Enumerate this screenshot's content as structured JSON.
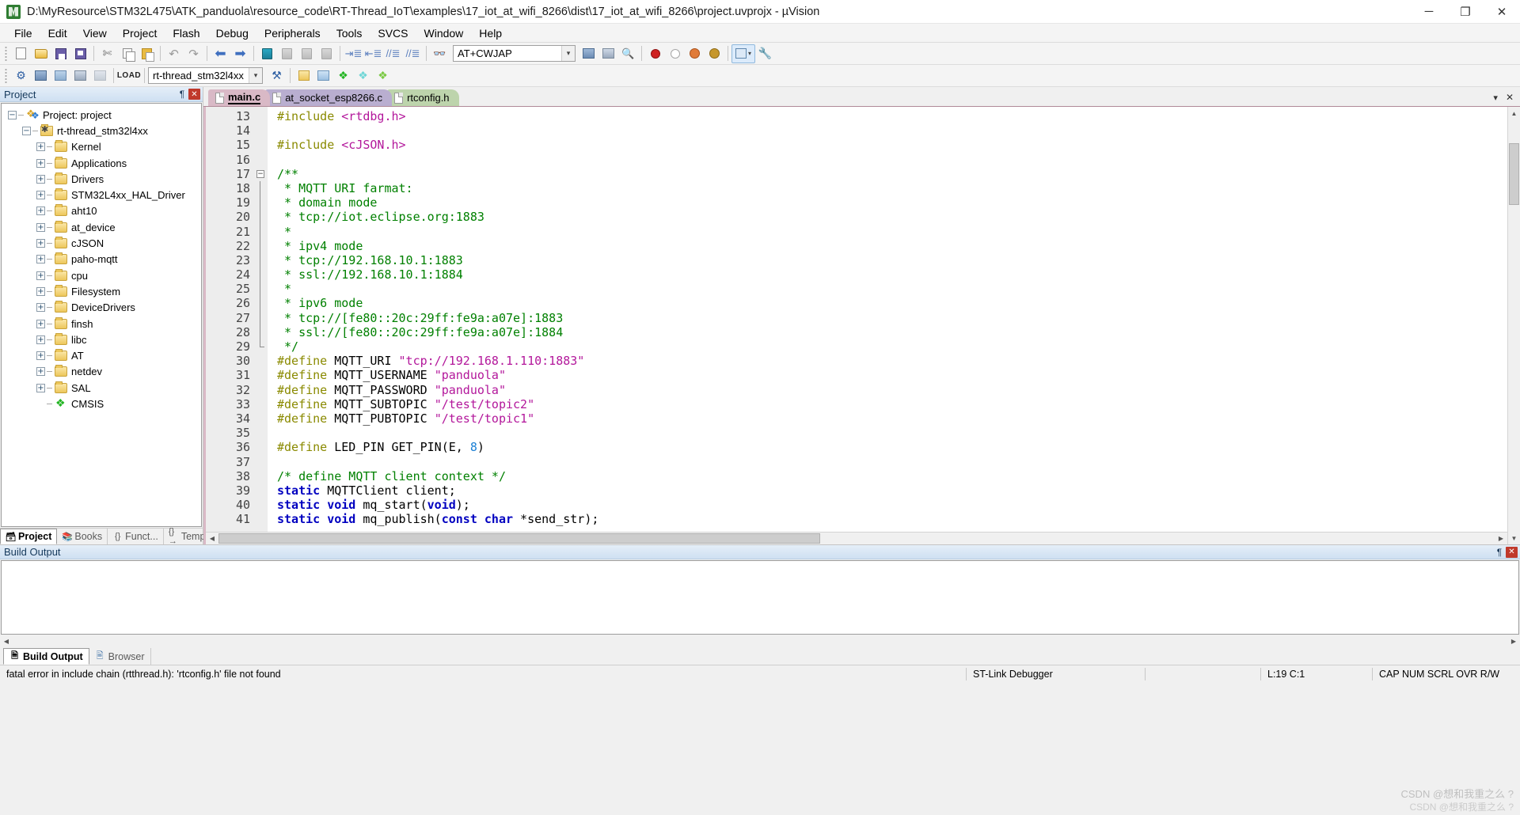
{
  "window": {
    "title": "D:\\MyResource\\STM32L475\\ATK_panduola\\resource_code\\RT-Thread_IoT\\examples\\17_iot_at_wifi_8266\\dist\\17_iot_at_wifi_8266\\project.uvprojx - µVision",
    "minimize": "─",
    "maximize": "❐",
    "close": "✕"
  },
  "menubar": {
    "items": [
      "File",
      "Edit",
      "View",
      "Project",
      "Flash",
      "Debug",
      "Peripherals",
      "Tools",
      "SVCS",
      "Window",
      "Help"
    ]
  },
  "toolbar1": {
    "search_box_value": "AT+CWJAP",
    "dropdown_arrow": "▾",
    "icons": [
      "new-file-icon",
      "open-file-icon",
      "save-icon",
      "save-all-icon",
      "cut-icon",
      "copy-icon",
      "paste-icon",
      "undo-icon",
      "redo-icon",
      "navigate-back-icon",
      "navigate-forward-icon",
      "bookmark-toggle-icon",
      "bookmark-prev-icon",
      "bookmark-next-icon",
      "bookmark-clear-icon",
      "indent-icon",
      "outdent-icon",
      "comment-icon",
      "uncomment-icon",
      "find-in-files-icon",
      "debug-window-icon",
      "configure-icon",
      "binoculars-icon",
      "insert-breakpoint-icon",
      "disable-breakpoint-icon",
      "disable-all-breakpoints-icon",
      "kill-all-breakpoints-icon",
      "window-layout-icon",
      "configure-tools-icon"
    ]
  },
  "toolbar2": {
    "target_value": "rt-thread_stm32l4xx",
    "dropdown_arrow": "▾",
    "load_label": "LOAD",
    "icons": [
      "translate-icon",
      "build-icon",
      "rebuild-icon",
      "batch-build-icon",
      "stop-build-icon",
      "download-icon",
      "target-options-icon",
      "manage-components-icon",
      "pack-installer-icon",
      "configuration-wizard-icon",
      "cmsis-manager-icon"
    ]
  },
  "project_panel": {
    "header": "Project",
    "pin_icon": "¶",
    "close_icon": "✕",
    "tree": [
      {
        "label": "Project: project",
        "depth": 0,
        "icon": "project-icon",
        "expander": "−"
      },
      {
        "label": "rt-thread_stm32l4xx",
        "depth": 1,
        "icon": "target-icon",
        "expander": "−"
      },
      {
        "label": "Kernel",
        "depth": 2,
        "icon": "folder-icon",
        "expander": "+"
      },
      {
        "label": "Applications",
        "depth": 2,
        "icon": "folder-icon",
        "expander": "+"
      },
      {
        "label": "Drivers",
        "depth": 2,
        "icon": "folder-icon",
        "expander": "+"
      },
      {
        "label": "STM32L4xx_HAL_Driver",
        "depth": 2,
        "icon": "folder-icon",
        "expander": "+"
      },
      {
        "label": "aht10",
        "depth": 2,
        "icon": "folder-icon",
        "expander": "+"
      },
      {
        "label": "at_device",
        "depth": 2,
        "icon": "folder-icon",
        "expander": "+"
      },
      {
        "label": "cJSON",
        "depth": 2,
        "icon": "folder-icon",
        "expander": "+"
      },
      {
        "label": "paho-mqtt",
        "depth": 2,
        "icon": "folder-icon",
        "expander": "+"
      },
      {
        "label": "cpu",
        "depth": 2,
        "icon": "folder-icon",
        "expander": "+"
      },
      {
        "label": "Filesystem",
        "depth": 2,
        "icon": "folder-icon",
        "expander": "+"
      },
      {
        "label": "DeviceDrivers",
        "depth": 2,
        "icon": "folder-icon",
        "expander": "+"
      },
      {
        "label": "finsh",
        "depth": 2,
        "icon": "folder-icon",
        "expander": "+"
      },
      {
        "label": "libc",
        "depth": 2,
        "icon": "folder-icon",
        "expander": "+"
      },
      {
        "label": "AT",
        "depth": 2,
        "icon": "folder-icon",
        "expander": "+"
      },
      {
        "label": "netdev",
        "depth": 2,
        "icon": "folder-icon",
        "expander": "+"
      },
      {
        "label": "SAL",
        "depth": 2,
        "icon": "folder-icon",
        "expander": "+"
      },
      {
        "label": "CMSIS",
        "depth": 2,
        "icon": "cmsis-icon",
        "expander": ""
      }
    ],
    "tabs": [
      {
        "label": "Project",
        "icon": "project-tab-icon",
        "active": true
      },
      {
        "label": "Books",
        "icon": "books-tab-icon",
        "active": false
      },
      {
        "label": "Funct...",
        "icon": "functions-tab-icon",
        "active": false
      },
      {
        "label": "Templ...",
        "icon": "templates-tab-icon",
        "active": false
      }
    ]
  },
  "editor": {
    "tabs": [
      {
        "label": "main.c",
        "active": true
      },
      {
        "label": "at_socket_esp8266.c",
        "active": false
      },
      {
        "label": "rtconfig.h",
        "active": false
      }
    ],
    "tabstrip_menu_icon": "▾",
    "tabstrip_close_icon": "✕",
    "first_line_number": 13,
    "lines": [
      {
        "n": 13,
        "fold": "",
        "tokens": [
          {
            "t": "#include ",
            "c": "k-pre"
          },
          {
            "t": "<rtdbg.h>",
            "c": "k-inc"
          }
        ]
      },
      {
        "n": 14,
        "fold": "",
        "tokens": []
      },
      {
        "n": 15,
        "fold": "",
        "tokens": [
          {
            "t": "#include ",
            "c": "k-pre"
          },
          {
            "t": "<cJSON.h>",
            "c": "k-inc"
          }
        ]
      },
      {
        "n": 16,
        "fold": "",
        "tokens": []
      },
      {
        "n": 17,
        "fold": "start",
        "tokens": [
          {
            "t": "/**",
            "c": "k-cmt"
          }
        ]
      },
      {
        "n": 18,
        "fold": "bar",
        "tokens": [
          {
            "t": " * MQTT URI farmat:",
            "c": "k-cmt"
          }
        ]
      },
      {
        "n": 19,
        "fold": "bar",
        "tokens": [
          {
            "t": " * domain mode",
            "c": "k-cmt"
          }
        ]
      },
      {
        "n": 20,
        "fold": "bar",
        "tokens": [
          {
            "t": " * tcp://iot.eclipse.org:1883",
            "c": "k-cmt"
          }
        ]
      },
      {
        "n": 21,
        "fold": "bar",
        "tokens": [
          {
            "t": " *",
            "c": "k-cmt"
          }
        ]
      },
      {
        "n": 22,
        "fold": "bar",
        "tokens": [
          {
            "t": " * ipv4 mode",
            "c": "k-cmt"
          }
        ]
      },
      {
        "n": 23,
        "fold": "bar",
        "tokens": [
          {
            "t": " * tcp://192.168.10.1:1883",
            "c": "k-cmt"
          }
        ]
      },
      {
        "n": 24,
        "fold": "bar",
        "tokens": [
          {
            "t": " * ssl://192.168.10.1:1884",
            "c": "k-cmt"
          }
        ]
      },
      {
        "n": 25,
        "fold": "bar",
        "tokens": [
          {
            "t": " *",
            "c": "k-cmt"
          }
        ]
      },
      {
        "n": 26,
        "fold": "bar",
        "tokens": [
          {
            "t": " * ipv6 mode",
            "c": "k-cmt"
          }
        ]
      },
      {
        "n": 27,
        "fold": "bar",
        "tokens": [
          {
            "t": " * tcp://[fe80::20c:29ff:fe9a:a07e]:1883",
            "c": "k-cmt"
          }
        ]
      },
      {
        "n": 28,
        "fold": "bar",
        "tokens": [
          {
            "t": " * ssl://[fe80::20c:29ff:fe9a:a07e]:1884",
            "c": "k-cmt"
          }
        ]
      },
      {
        "n": 29,
        "fold": "end",
        "tokens": [
          {
            "t": " */",
            "c": "k-cmt"
          }
        ]
      },
      {
        "n": 30,
        "fold": "",
        "tokens": [
          {
            "t": "#define ",
            "c": "k-pre"
          },
          {
            "t": "MQTT_URI ",
            "c": "k-txt"
          },
          {
            "t": "\"tcp://192.168.1.110:1883\"",
            "c": "k-str"
          }
        ]
      },
      {
        "n": 31,
        "fold": "",
        "tokens": [
          {
            "t": "#define ",
            "c": "k-pre"
          },
          {
            "t": "MQTT_USERNAME ",
            "c": "k-txt"
          },
          {
            "t": "\"panduola\"",
            "c": "k-str"
          }
        ]
      },
      {
        "n": 32,
        "fold": "",
        "tokens": [
          {
            "t": "#define ",
            "c": "k-pre"
          },
          {
            "t": "MQTT_PASSWORD ",
            "c": "k-txt"
          },
          {
            "t": "\"panduola\"",
            "c": "k-str"
          }
        ]
      },
      {
        "n": 33,
        "fold": "",
        "tokens": [
          {
            "t": "#define ",
            "c": "k-pre"
          },
          {
            "t": "MQTT_SUBTOPIC ",
            "c": "k-txt"
          },
          {
            "t": "\"/test/topic2\"",
            "c": "k-str"
          }
        ]
      },
      {
        "n": 34,
        "fold": "",
        "tokens": [
          {
            "t": "#define ",
            "c": "k-pre"
          },
          {
            "t": "MQTT_PUBTOPIC ",
            "c": "k-txt"
          },
          {
            "t": "\"/test/topic1\"",
            "c": "k-str"
          }
        ]
      },
      {
        "n": 35,
        "fold": "",
        "tokens": []
      },
      {
        "n": 36,
        "fold": "",
        "tokens": [
          {
            "t": "#define ",
            "c": "k-pre"
          },
          {
            "t": "LED_PIN GET_PIN(E, ",
            "c": "k-txt"
          },
          {
            "t": "8",
            "c": "k-num"
          },
          {
            "t": ")",
            "c": "k-txt"
          }
        ]
      },
      {
        "n": 37,
        "fold": "",
        "tokens": []
      },
      {
        "n": 38,
        "fold": "",
        "tokens": [
          {
            "t": "/* define MQTT client context */",
            "c": "k-cmt"
          }
        ]
      },
      {
        "n": 39,
        "fold": "",
        "tokens": [
          {
            "t": "static",
            "c": "k-kw"
          },
          {
            "t": " MQTTClient client;",
            "c": "k-txt"
          }
        ]
      },
      {
        "n": 40,
        "fold": "",
        "tokens": [
          {
            "t": "static",
            "c": "k-kw"
          },
          {
            "t": " ",
            "c": "k-txt"
          },
          {
            "t": "void",
            "c": "k-kw"
          },
          {
            "t": " mq_start(",
            "c": "k-txt"
          },
          {
            "t": "void",
            "c": "k-kw"
          },
          {
            "t": ");",
            "c": "k-txt"
          }
        ]
      },
      {
        "n": 41,
        "fold": "",
        "tokens": [
          {
            "t": "static",
            "c": "k-kw"
          },
          {
            "t": " ",
            "c": "k-txt"
          },
          {
            "t": "void",
            "c": "k-kw"
          },
          {
            "t": " mq_publish(",
            "c": "k-txt"
          },
          {
            "t": "const",
            "c": "k-kw"
          },
          {
            "t": " ",
            "c": "k-txt"
          },
          {
            "t": "char",
            "c": "k-kw"
          },
          {
            "t": " *send_str);",
            "c": "k-txt"
          }
        ]
      }
    ],
    "scroll_up_arrow": "▲",
    "scroll_down_arrow": "▼",
    "scroll_left_arrow": "◀",
    "scroll_right_arrow": "▶"
  },
  "build_output": {
    "header": "Build Output",
    "pin_icon": "¶",
    "close_icon": "✕",
    "text": "",
    "scroll_left_arrow": "◀",
    "scroll_right_arrow": "▶"
  },
  "bottom_tabs": [
    {
      "label": "Build Output",
      "icon": "build-output-tab-icon",
      "active": true
    },
    {
      "label": "Browser",
      "icon": "browser-tab-icon",
      "active": false
    }
  ],
  "statusbar": {
    "message": "fatal error in include chain (rtthread.h): 'rtconfig.h' file not found",
    "debugger": "ST-Link Debugger",
    "blank": "",
    "position": "L:19 C:1",
    "indicators": "CAP NUM SCRL OVR R/W"
  },
  "watermark": {
    "line1": "CSDN @想和我重之么 ?",
    "line2": "CSDN @想和我重之么 ?"
  },
  "colors": {
    "title_bar": "#ffffff",
    "toolbar": "#f4f4f4",
    "panel_header": "#cfe0f2",
    "tab_main": "#d9b9c6",
    "tab_socket": "#b9aed0",
    "tab_rtconfig": "#bdd4ac",
    "comment": "#008000",
    "string": "#b3179b",
    "keyword": "#0000c0",
    "preprocessor": "#8a8a00",
    "number": "#1a7fd4"
  }
}
